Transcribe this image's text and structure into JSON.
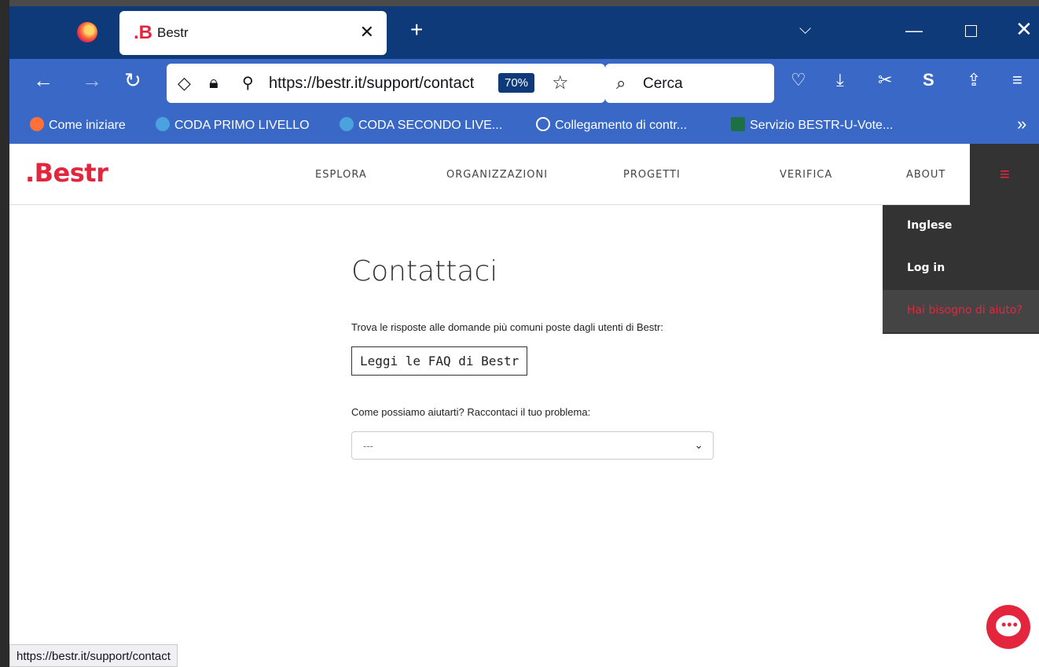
{
  "browser": {
    "tab": {
      "favicon": ".B",
      "title": "Bestr"
    },
    "url": "https://bestr.it/support/contact",
    "zoom": "70%",
    "search_placeholder": "Cerca",
    "bookmarks": [
      {
        "label": "Come iniziare",
        "color": "#ff7139"
      },
      {
        "label": "CODA PRIMO LIVELLO",
        "color": "#4aa3df"
      },
      {
        "label": "CODA SECONDO LIVE...",
        "color": "#4aa3df"
      },
      {
        "label": "Collegamento di contr...",
        "color": "#ffffff"
      },
      {
        "label": "Servizio BESTR-U-Vote...",
        "color": "#1d7044"
      }
    ],
    "status_url": "https://bestr.it/support/contact"
  },
  "site": {
    "logo": ".Bestr",
    "menu": [
      "ESPLORA",
      "ORGANIZZAZIONI",
      "PROGETTI",
      "VERIFICA",
      "ABOUT"
    ],
    "dropdown": {
      "language": "Inglese",
      "login": "Log in",
      "help": "Hai bisogno di aiuto?"
    },
    "accent": "#e3263e"
  },
  "contact": {
    "title": "Contattaci",
    "faq_intro": "Trova le risposte alle domande più comuni poste dagli utenti di Bestr:",
    "faq_button": "Leggi le FAQ di Bestr",
    "problem_label": "Come possiamo aiutarti? Raccontaci il tuo problema:",
    "select_value": "---"
  }
}
